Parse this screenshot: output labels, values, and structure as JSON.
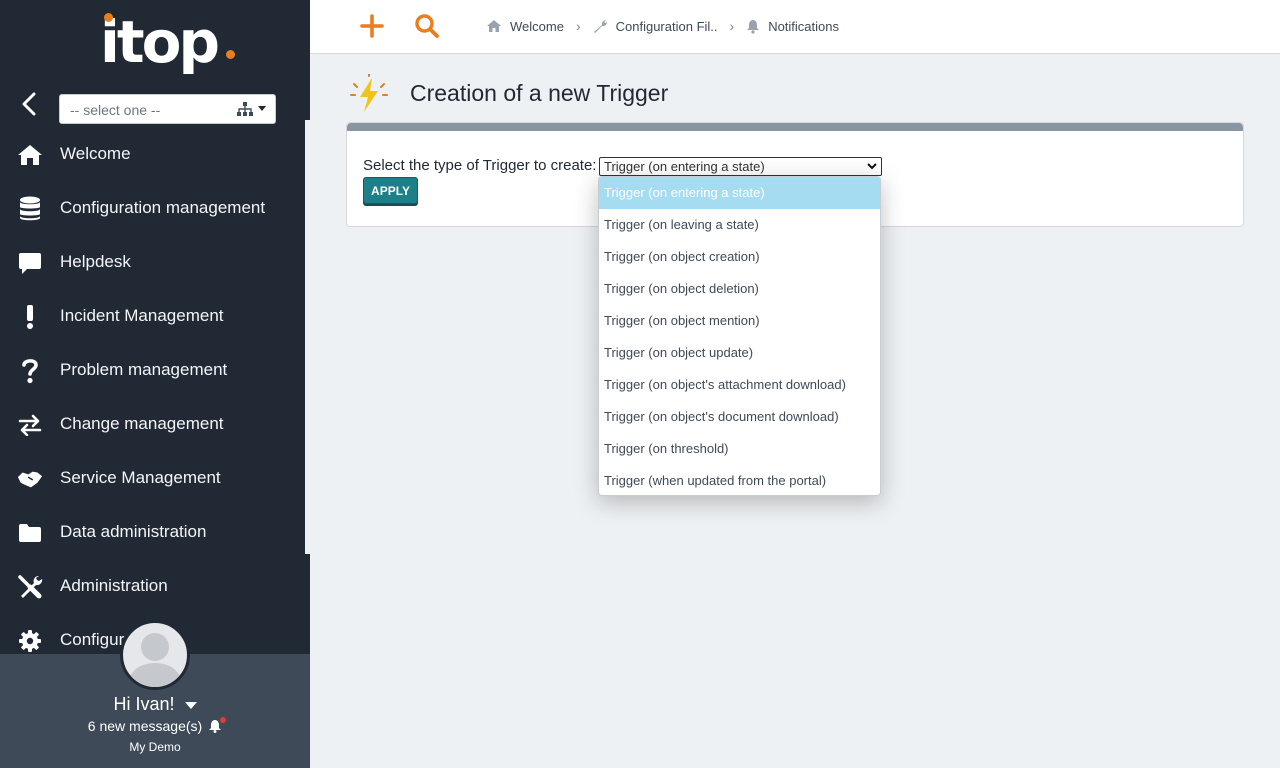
{
  "app": {
    "logo_text": "itop"
  },
  "sidebar": {
    "org_select": {
      "value": "-- select one --"
    },
    "items": [
      {
        "label": "Welcome",
        "icon": "home-icon"
      },
      {
        "label": "Configuration management",
        "icon": "database-icon"
      },
      {
        "label": "Helpdesk",
        "icon": "chat-icon"
      },
      {
        "label": "Incident Management",
        "icon": "exclamation-icon"
      },
      {
        "label": "Problem management",
        "icon": "question-icon"
      },
      {
        "label": "Change management",
        "icon": "exchange-icon"
      },
      {
        "label": "Service Management",
        "icon": "handshake-icon"
      },
      {
        "label": "Data administration",
        "icon": "folder-icon"
      },
      {
        "label": "Administration",
        "icon": "tools-icon"
      },
      {
        "label": "Configur",
        "icon": "gear-icon"
      }
    ],
    "user": {
      "greeting": "Hi Ivan!",
      "messages": "6 new message(s)",
      "org": "My Demo"
    }
  },
  "topbar": {
    "breadcrumbs": [
      {
        "label": "Welcome",
        "icon": "home-icon"
      },
      {
        "label": "Configuration Fil..",
        "icon": "wrench-icon"
      },
      {
        "label": "Notifications",
        "icon": "bell-icon"
      }
    ]
  },
  "page": {
    "title": "Creation of a new Trigger",
    "form_label": "Select the type of Trigger to create:",
    "selected_type": "Trigger (on entering a state)",
    "apply_label": "APPLY",
    "options": [
      "Trigger (on entering a state)",
      "Trigger (on leaving a state)",
      "Trigger (on object creation)",
      "Trigger (on object deletion)",
      "Trigger (on object mention)",
      "Trigger (on object update)",
      "Trigger (on object's attachment download)",
      "Trigger (on object's document download)",
      "Trigger (on threshold)",
      "Trigger (when updated from the portal)"
    ]
  },
  "colors": {
    "sidebar_bg": "#212934",
    "user_panel_bg": "#3e4a58",
    "brand_orange": "#ea7d1e",
    "apply_button": "#1d7f87",
    "selected_option": "#a6dcf2"
  }
}
